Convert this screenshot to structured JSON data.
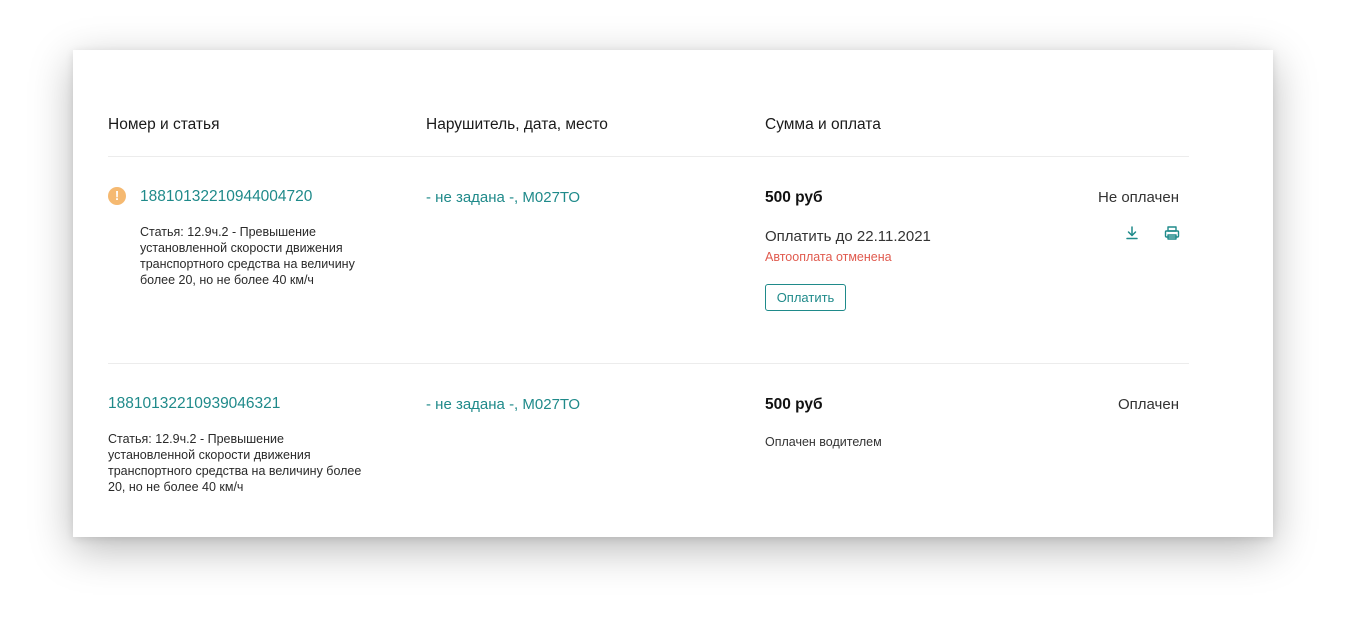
{
  "table": {
    "headers": {
      "number": "Номер и статья",
      "offender": "Нарушитель, дата, место",
      "payment": "Сумма и оплата"
    },
    "rows": [
      {
        "warning": true,
        "warning_icon": "exclamation-icon",
        "number": "18810132210944004720",
        "article": "Статья: 12.9ч.2 - Превышение установленной скорости движения транспортного средства на величину более 20, но не более 40 км/ч",
        "offender": "- не задана -, М027ТО",
        "amount": "500 руб",
        "status": "Не оплачен",
        "due": "Оплатить до 22.11.2021",
        "autopay": "Автооплата отменена",
        "pay_button": "Оплатить",
        "actions": [
          "download-icon",
          "print-icon"
        ]
      },
      {
        "warning": false,
        "number": "18810132210939046321",
        "article": "Статья: 12.9ч.2 - Превышение установленной скорости движения транспортного средства на величину более 20, но не более 40 км/ч",
        "offender": "- не задана -, М027ТО",
        "amount": "500 руб",
        "status": "Оплачен",
        "paid_by": "Оплачен водителем"
      }
    ]
  },
  "colors": {
    "accent": "#1f8a8a",
    "warning": "#f5b971",
    "error": "#e05a4e"
  }
}
